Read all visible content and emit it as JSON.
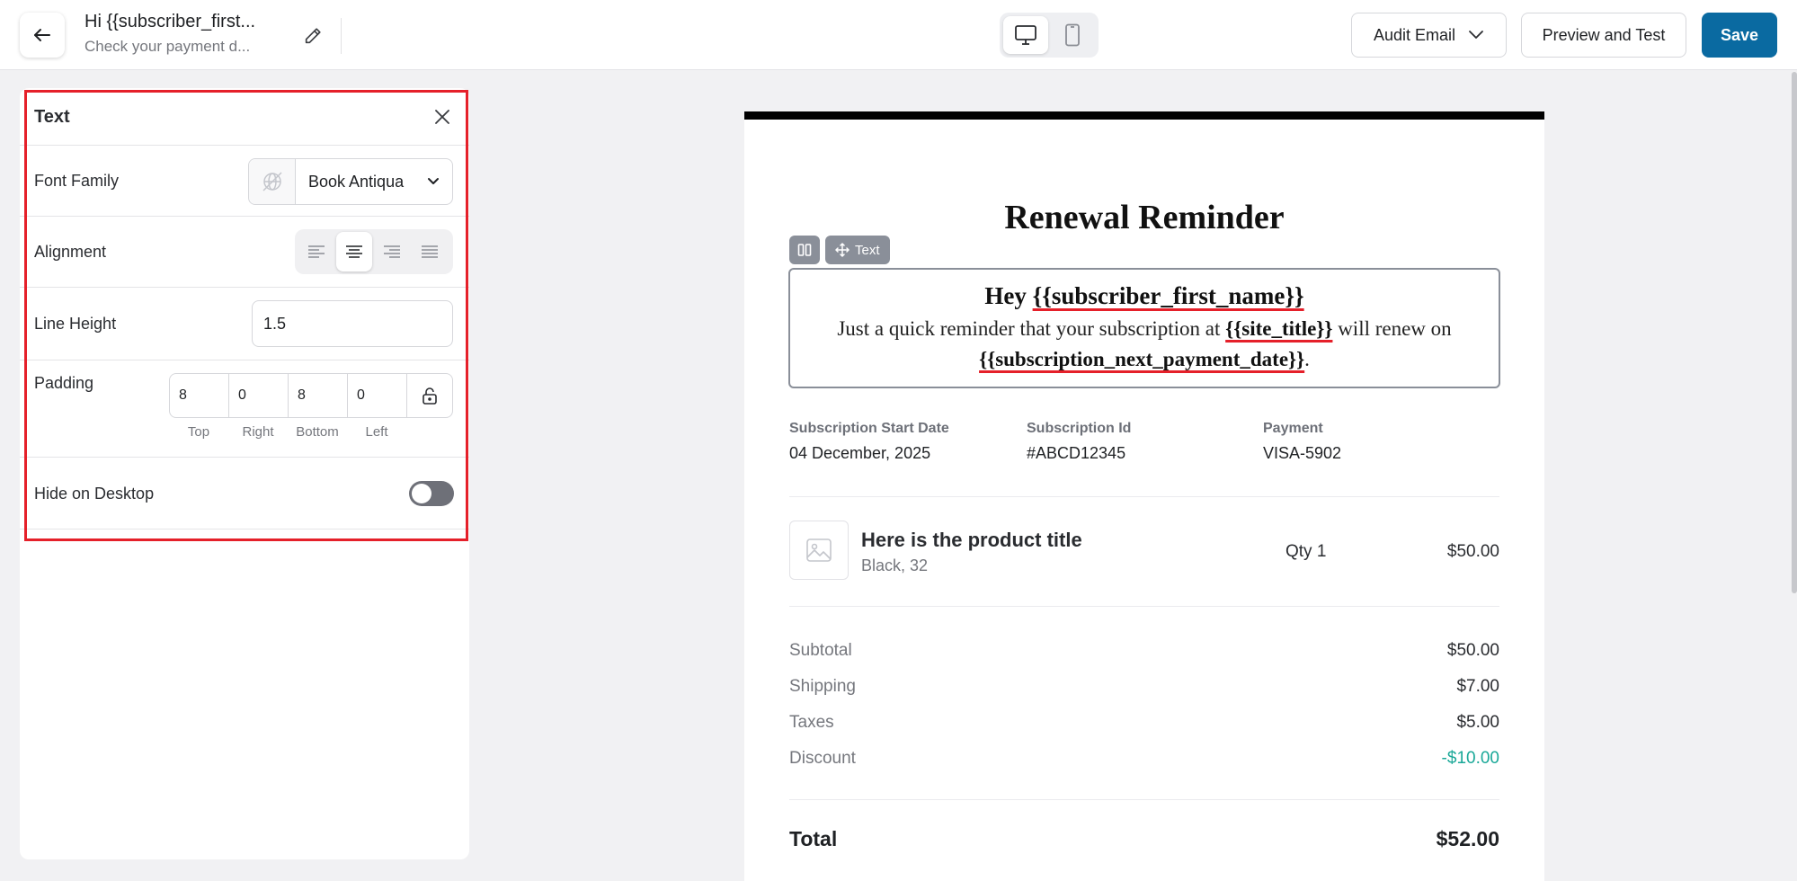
{
  "topbar": {
    "email_title": "Hi {{subscriber_first...",
    "email_subtitle": "Check your payment d...",
    "audit_label": "Audit Email",
    "preview_label": "Preview and Test",
    "save_label": "Save",
    "accent_color": "#0a6aa1"
  },
  "panel": {
    "title": "Text",
    "font_family_label": "Font Family",
    "font_family_value": "Book Antiqua",
    "alignment_label": "Alignment",
    "alignment_selected": "center",
    "line_height_label": "Line Height",
    "line_height_value": "1.5",
    "padding_label": "Padding",
    "padding": {
      "top": "8",
      "right": "0",
      "bottom": "8",
      "left": "0",
      "top_label": "Top",
      "right_label": "Right",
      "bottom_label": "Bottom",
      "left_label": "Left"
    },
    "hide_desktop_label": "Hide on Desktop",
    "hide_desktop_on": false
  },
  "email": {
    "heading": "Renewal Reminder",
    "toolbar_text_chip": "Text",
    "text_block": {
      "greeting_prefix": "Hey ",
      "greeting_var": "{{subscriber_first_name}}",
      "body_prefix": "Just a quick reminder that your subscription at ",
      "site_var": "{{site_title}}",
      "body_middle": " will renew on ",
      "date_var": "{{subscription_next_payment_date}}",
      "body_suffix": "."
    },
    "meta": [
      {
        "label": "Subscription Start Date",
        "value": "04 December, 2025"
      },
      {
        "label": "Subscription Id",
        "value": "#ABCD12345"
      },
      {
        "label": "Payment",
        "value": "VISA-5902"
      }
    ],
    "product": {
      "title": "Here is the product title",
      "variant": "Black, 32",
      "qty": "Qty 1",
      "price": "$50.00"
    },
    "summary": [
      {
        "label": "Subtotal",
        "value": "$50.00"
      },
      {
        "label": "Shipping",
        "value": "$7.00"
      },
      {
        "label": "Taxes",
        "value": "$5.00"
      },
      {
        "label": "Discount",
        "value": "-$10.00"
      }
    ],
    "total": {
      "label": "Total",
      "value": "$52.00"
    },
    "discount_color": "#1aa898"
  }
}
